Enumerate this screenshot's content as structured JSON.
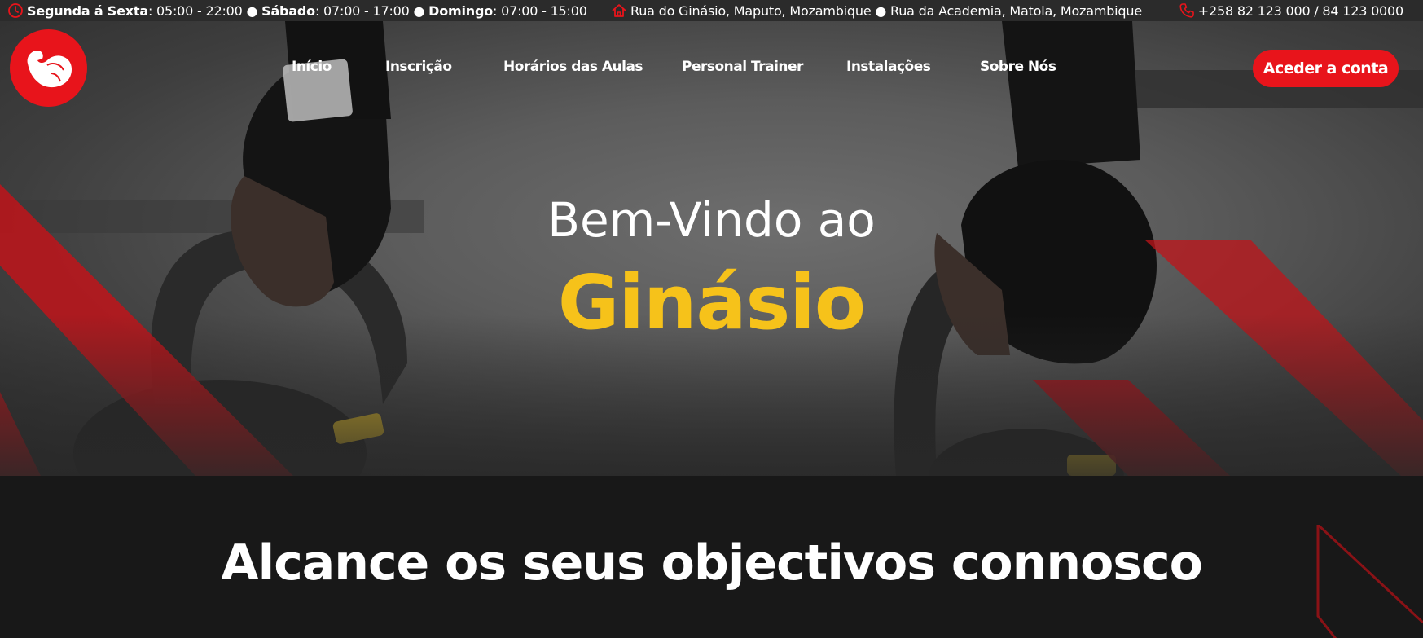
{
  "topbar": {
    "hours_weekday_label": "Segunda á Sexta",
    "hours_weekday_value": ": 05:00 - 22:00 ● ",
    "hours_saturday_label": "Sábado",
    "hours_saturday_value": ": 07:00 - 17:00 ● ",
    "hours_sunday_label": "Domingo",
    "hours_sunday_value": ": 07:00 - 15:00",
    "address": "Rua do Ginásio, Maputo, Mozambique ● Rua da Academia, Matola, Mozambique",
    "phone": "+258 82 123 000 / 84 123 0000",
    "icons": {
      "hours": "clock-icon",
      "address": "home-icon",
      "phone": "phone-icon"
    },
    "icon_color": "#e8141b"
  },
  "nav": {
    "logo_icon": "flexed-arm-icon",
    "items": [
      {
        "label": "Início"
      },
      {
        "label": "Inscrição"
      },
      {
        "label": "Horários das Aulas"
      },
      {
        "label": "Personal Trainer"
      },
      {
        "label": "Instalações"
      },
      {
        "label": "Sobre Nós"
      }
    ],
    "login_label": "Aceder a conta"
  },
  "hero": {
    "welcome": "Bem-Vindo ao",
    "gym_name": "Ginásio"
  },
  "section": {
    "heading": "Alcance os seus objectivos connosco"
  },
  "colors": {
    "accent_red": "#e8141b",
    "accent_yellow": "#f6c21a",
    "topbar_bg": "#2b2b2b",
    "section_bg": "#181818"
  }
}
